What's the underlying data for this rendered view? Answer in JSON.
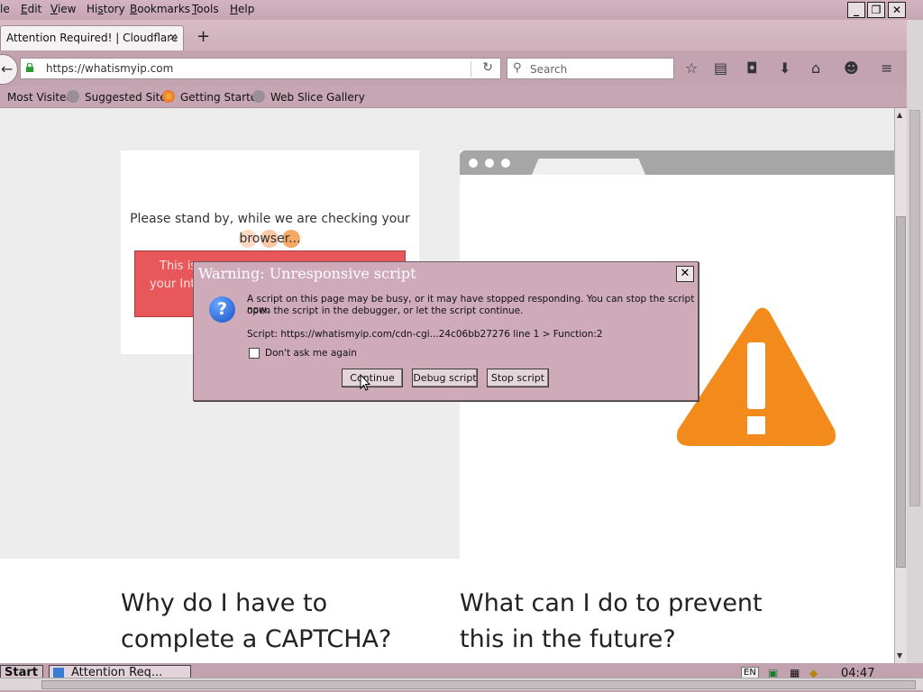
{
  "menubar": {
    "items": [
      "le",
      "Edit",
      "View",
      "History",
      "Bookmarks",
      "Tools",
      "Help"
    ],
    "underline": [
      "",
      "E",
      "V",
      "s",
      "B",
      "T",
      "H"
    ]
  },
  "tab": {
    "title": "Attention Required! | Cloudflare",
    "close": "×"
  },
  "newtab": "+",
  "navbar": {
    "url": "https://whatismyip.com",
    "search_placeholder": "Search"
  },
  "bookmarks": [
    "Most Visited",
    "Suggested Sites",
    "Getting Started",
    "Web Slice Gallery"
  ],
  "page": {
    "standby_line1": "Please stand by, while we are checking your",
    "standby_line2": "browser...",
    "red_line1": "This is",
    "red_line2": "your Inte",
    "heading_left_1": "Why do I have to",
    "heading_left_2": "complete a CAPTCHA?",
    "heading_right_1": "What can I do to prevent",
    "heading_right_2": "this in the future?"
  },
  "dialog": {
    "title": "Warning: Unresponsive script",
    "close": "✕",
    "message_line1": "A script on this page may be busy, or it may have stopped responding. You can stop the script now,",
    "message_line2": "open the script in the debugger, or let the script continue.",
    "script_line": "Script: https://whatismyip.com/cdn-cgi...24c06bb27276 line 1 > Function:2",
    "checkbox_label": "Don't ask me again",
    "buttons": {
      "continue": "Continue",
      "debug": "Debug script",
      "stop": "Stop script"
    }
  },
  "taskbar": {
    "start": "Start",
    "task_item": "Attention Req...",
    "lang": "EN",
    "clock": "04:47"
  },
  "colors": {
    "chrome": "#c9a9b4",
    "dialog": "#cfaab8",
    "red_box": "#e8585a",
    "dots": [
      "#fbd9c3",
      "#f9c9a6",
      "#f6a865"
    ],
    "warning_orange": "#f28b1c"
  }
}
